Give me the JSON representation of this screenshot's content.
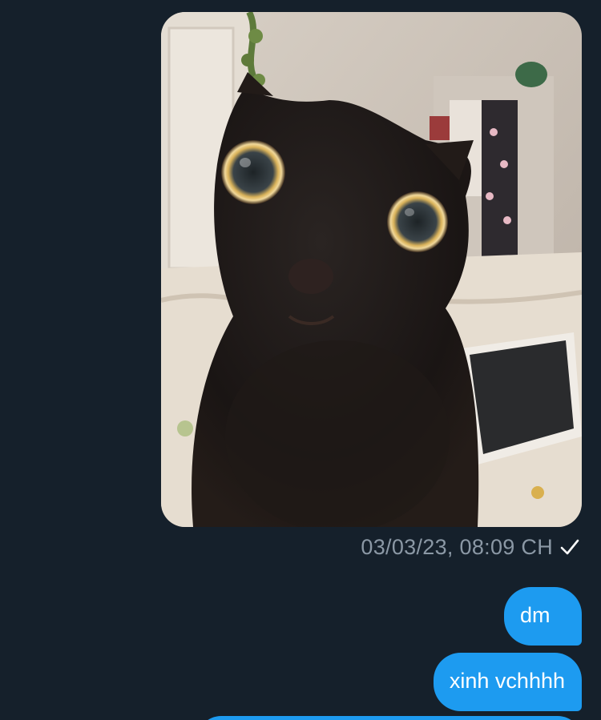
{
  "conversation": {
    "photo_message": {
      "alt": "black cat photo",
      "timestamp": "03/03/23, 08:09 CH",
      "status_icon": "check-icon"
    },
    "messages": [
      {
        "text": "dm"
      },
      {
        "text": "xinh vchhhh"
      }
    ]
  },
  "colors": {
    "background": "#15202b",
    "bubble": "#1d9bf0",
    "meta_text": "#8b98a5"
  }
}
